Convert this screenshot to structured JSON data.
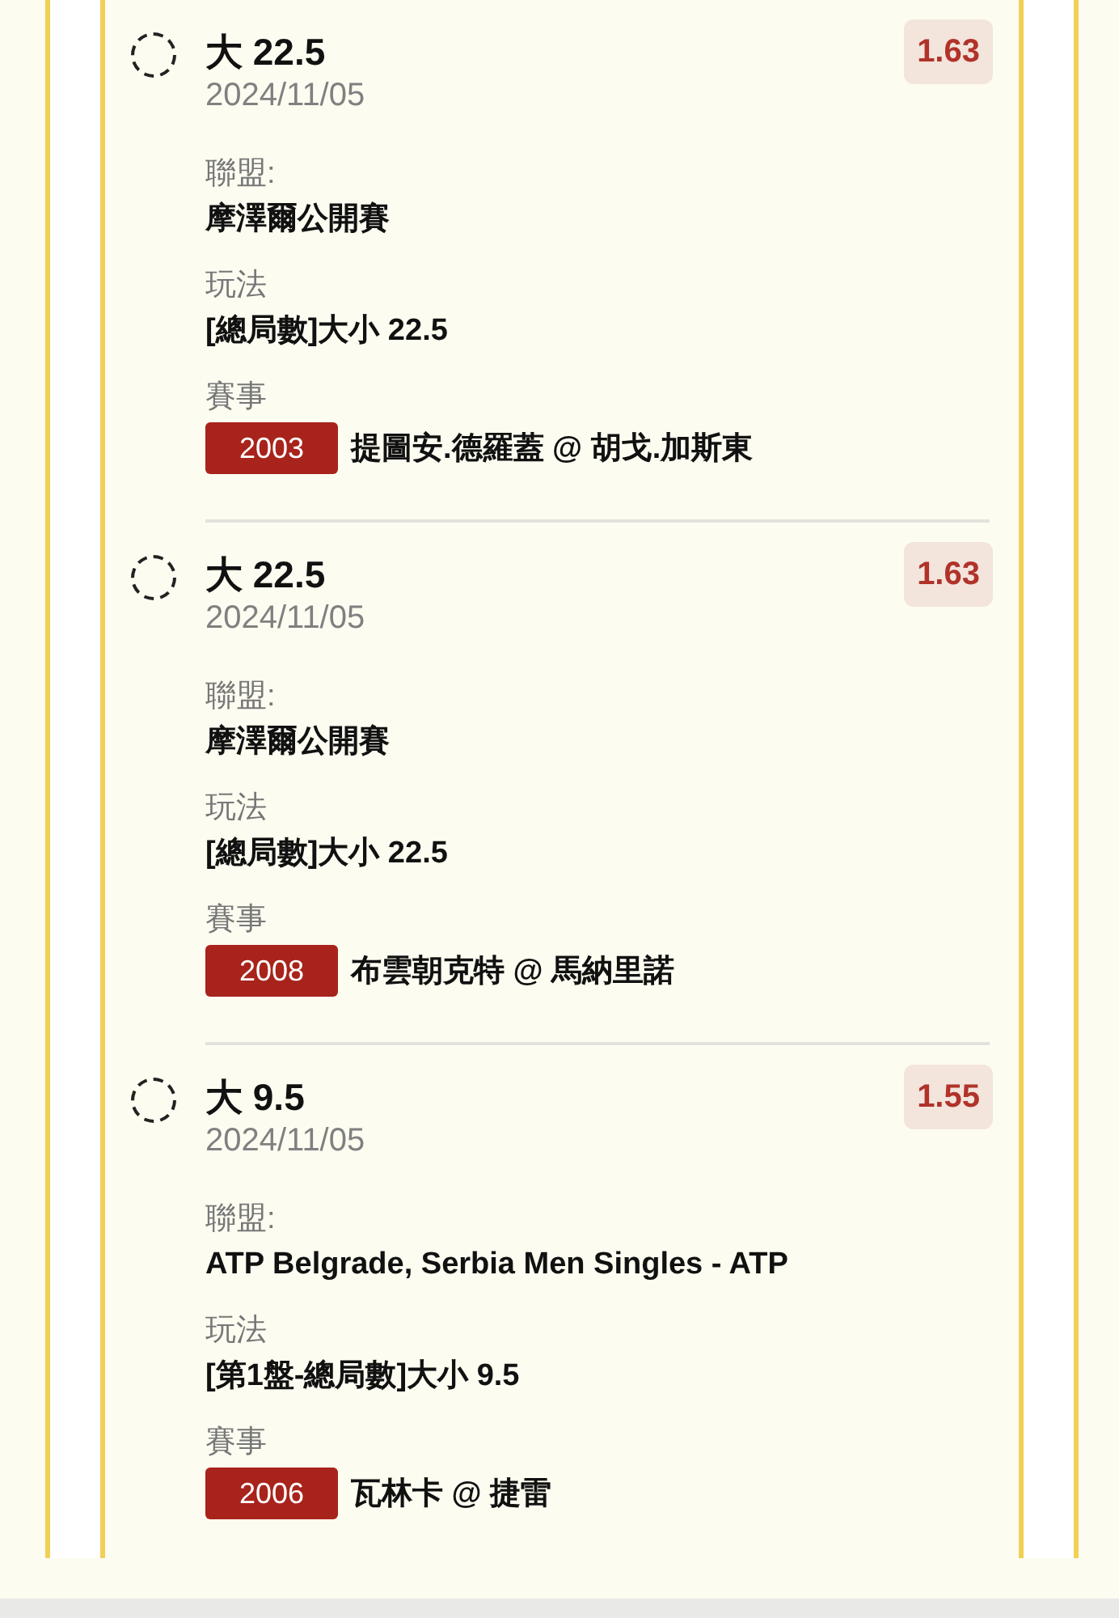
{
  "bets": [
    {
      "selected": false,
      "title": "大 22.5",
      "date": "2024/11/05",
      "odds": "1.63",
      "league_label": "聯盟:",
      "league": "摩澤爾公開賽",
      "market_label": "玩法",
      "market": "[總局數]大小 22.5",
      "event_label": "賽事",
      "event_code": "2003",
      "event": "提圖安.德羅蓋 @ 胡戈.加斯東"
    },
    {
      "selected": false,
      "title": "大 22.5",
      "date": "2024/11/05",
      "odds": "1.63",
      "league_label": "聯盟:",
      "league": "摩澤爾公開賽",
      "market_label": "玩法",
      "market": "[總局數]大小 22.5",
      "event_label": "賽事",
      "event_code": "2008",
      "event": "布雲朝克特 @ 馬納里諾"
    },
    {
      "selected": false,
      "title": "大 9.5",
      "date": "2024/11/05",
      "odds": "1.55",
      "league_label": "聯盟:",
      "league": "ATP Belgrade, Serbia Men Singles - ATP",
      "market_label": "玩法",
      "market": "[第1盤-總局數]大小 9.5",
      "event_label": "賽事",
      "event_code": "2006",
      "event": "瓦林卡 @ 捷雷"
    }
  ]
}
